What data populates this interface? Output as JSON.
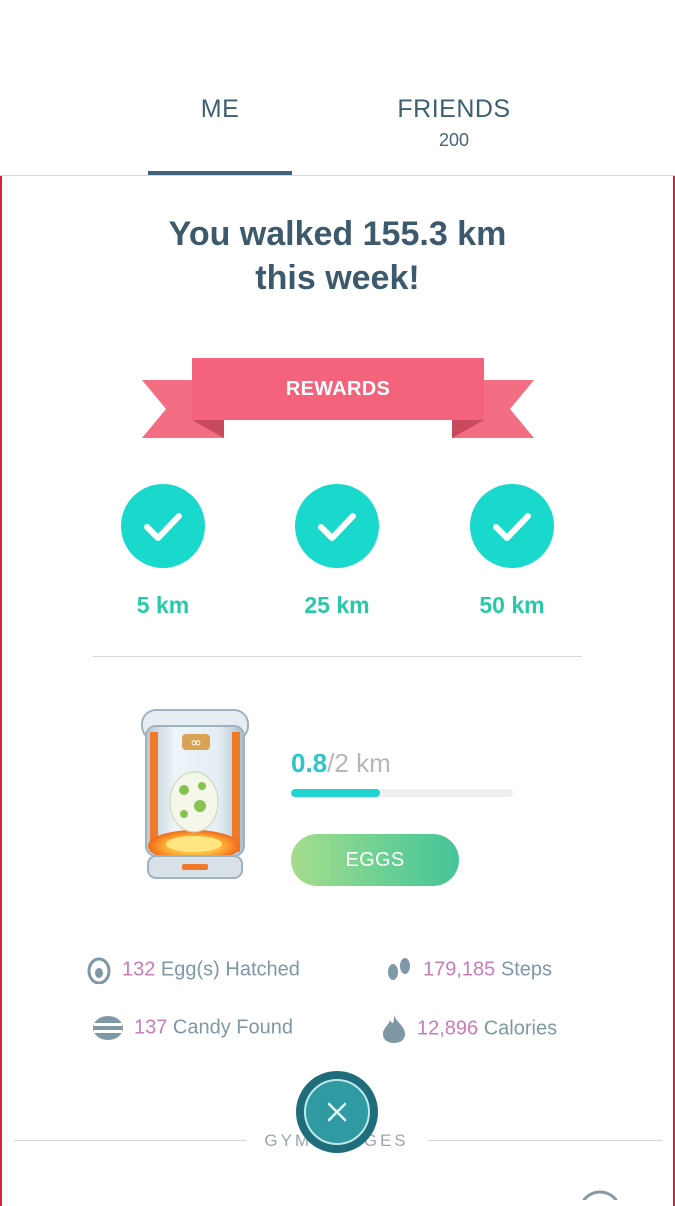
{
  "tabs": {
    "me": {
      "label": "ME"
    },
    "friends": {
      "label": "FRIENDS",
      "count": "200"
    }
  },
  "headline": {
    "line1": "You walked 155.3 km",
    "line2": "this week!"
  },
  "rewards": {
    "title": "REWARDS",
    "milestones": [
      {
        "label": "5 km",
        "achieved": true
      },
      {
        "label": "25 km",
        "achieved": true
      },
      {
        "label": "50 km",
        "achieved": true
      }
    ]
  },
  "incubator": {
    "walked": "0.8",
    "total": "/2 km",
    "progress_fraction": 0.4,
    "button_label": "EGGS",
    "icon": "egg-incubator-icon"
  },
  "stats": [
    {
      "value": "132",
      "label": " Egg(s) Hatched",
      "icon": "egg-icon"
    },
    {
      "value": "179,185",
      "label": " Steps",
      "icon": "footprints-icon"
    },
    {
      "value": "137",
      "label": " Candy Found",
      "icon": "candy-icon"
    },
    {
      "value": "12,896",
      "label": " Calories",
      "icon": "flame-icon"
    }
  ],
  "gym_badges": {
    "label": "GYM BADGES"
  },
  "colors": {
    "accent_teal": "#18d9cc",
    "ribbon_pink": "#f4637c",
    "border_red": "#d6223a",
    "stat_number": "#c97db8",
    "heading": "#3d5a6c"
  }
}
